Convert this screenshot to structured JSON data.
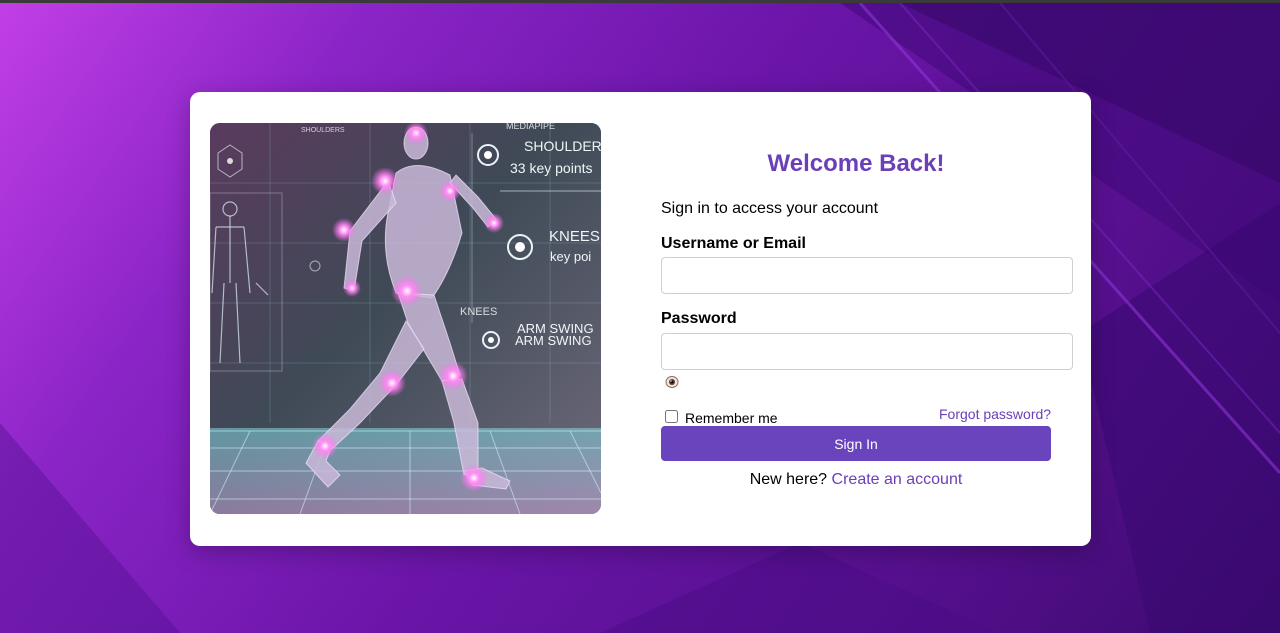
{
  "background": {
    "gradient_colors": [
      "#c13fe6",
      "#8a24c6",
      "#6a15a8",
      "#56108f",
      "#3d0a6e"
    ]
  },
  "hero_image": {
    "labels": {
      "shoulders_small": "SHOULDERS",
      "mediapipe": "MEDIAPIPE",
      "shoulder": "SHOULDER",
      "key_points": "33 key points",
      "knees": "KNEES",
      "key_po": "key poi",
      "knees_small": "KNEES",
      "arm_swing_1": "ARM SWING",
      "arm_swing_2": "ARM SWING"
    },
    "colors": {
      "glow": "#ff6cf0",
      "grid": "#9fe8ee",
      "body": "#c9b8d8"
    }
  },
  "form": {
    "title": "Welcome Back!",
    "subtitle": "Sign in to access your account",
    "username_label": "Username or Email",
    "username_value": "",
    "username_placeholder": "",
    "password_label": "Password",
    "password_value": "",
    "password_placeholder": "",
    "toggle_icon": "eye-icon",
    "remember_label": "Remember me",
    "forgot_label": "Forgot password?",
    "signin_label": "Sign In",
    "new_here_text": "New here? ",
    "create_account_label": "Create an account"
  },
  "colors": {
    "accent": "#6a3fb8",
    "button": "#6a44bd",
    "card": "#ffffff"
  }
}
